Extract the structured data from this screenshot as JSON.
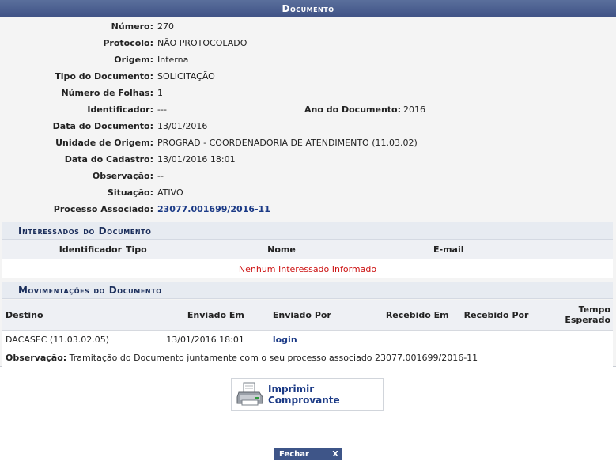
{
  "caption": "Documento",
  "fields": {
    "numero_label": "Número:",
    "numero": "270",
    "protocolo_label": "Protocolo:",
    "protocolo": "NÃO PROTOCOLADO",
    "origem_label": "Origem:",
    "origem": "Interna",
    "tipo_label": "Tipo do Documento:",
    "tipo": "SOLICITAÇÃO",
    "folhas_label": "Número de Folhas:",
    "folhas": "1",
    "identificador_label": "Identificador:",
    "identificador": "---",
    "ano_label": "Ano do Documento:",
    "ano": "2016",
    "data_doc_label": "Data do Documento:",
    "data_doc": "13/01/2016",
    "unidade_label": "Unidade de Origem:",
    "unidade": "PROGRAD - COORDENADORIA DE ATENDIMENTO (11.03.02)",
    "data_cad_label": "Data do Cadastro:",
    "data_cad": "13/01/2016 18:01",
    "obs_label": "Observação:",
    "obs": "--",
    "situacao_label": "Situação:",
    "situacao": "ATIVO",
    "processo_label": "Processo Associado:",
    "processo": "23077.001699/2016-11"
  },
  "interessados": {
    "title": "Interessados do Documento",
    "headers": [
      "Identificador",
      "Tipo",
      "Nome",
      "E-mail"
    ],
    "empty": "Nenhum Interessado Informado"
  },
  "movimentacoes": {
    "title": "Movimentações do Documento",
    "headers": [
      "Destino",
      "Enviado Em",
      "Enviado Por",
      "Recebido Em",
      "Recebido Por",
      "Tempo Esperado"
    ],
    "row": {
      "destino": "DACASEC (11.03.02.05)",
      "enviado_em": "13/01/2016 18:01",
      "enviado_por": "login",
      "recebido_em": "",
      "recebido_por": "",
      "tempo": ""
    },
    "obs_label": "Observação:",
    "obs": "Tramitação do Documento juntamente com o seu processo associado 23077.001699/2016-11"
  },
  "actions": {
    "imprimir": "Imprimir Comprovante",
    "fechar": "Fechar",
    "fechar_x": "X"
  },
  "colors": {
    "header_bg": "#3f5285",
    "link": "#1b3a86",
    "empty_text": "#c11"
  }
}
